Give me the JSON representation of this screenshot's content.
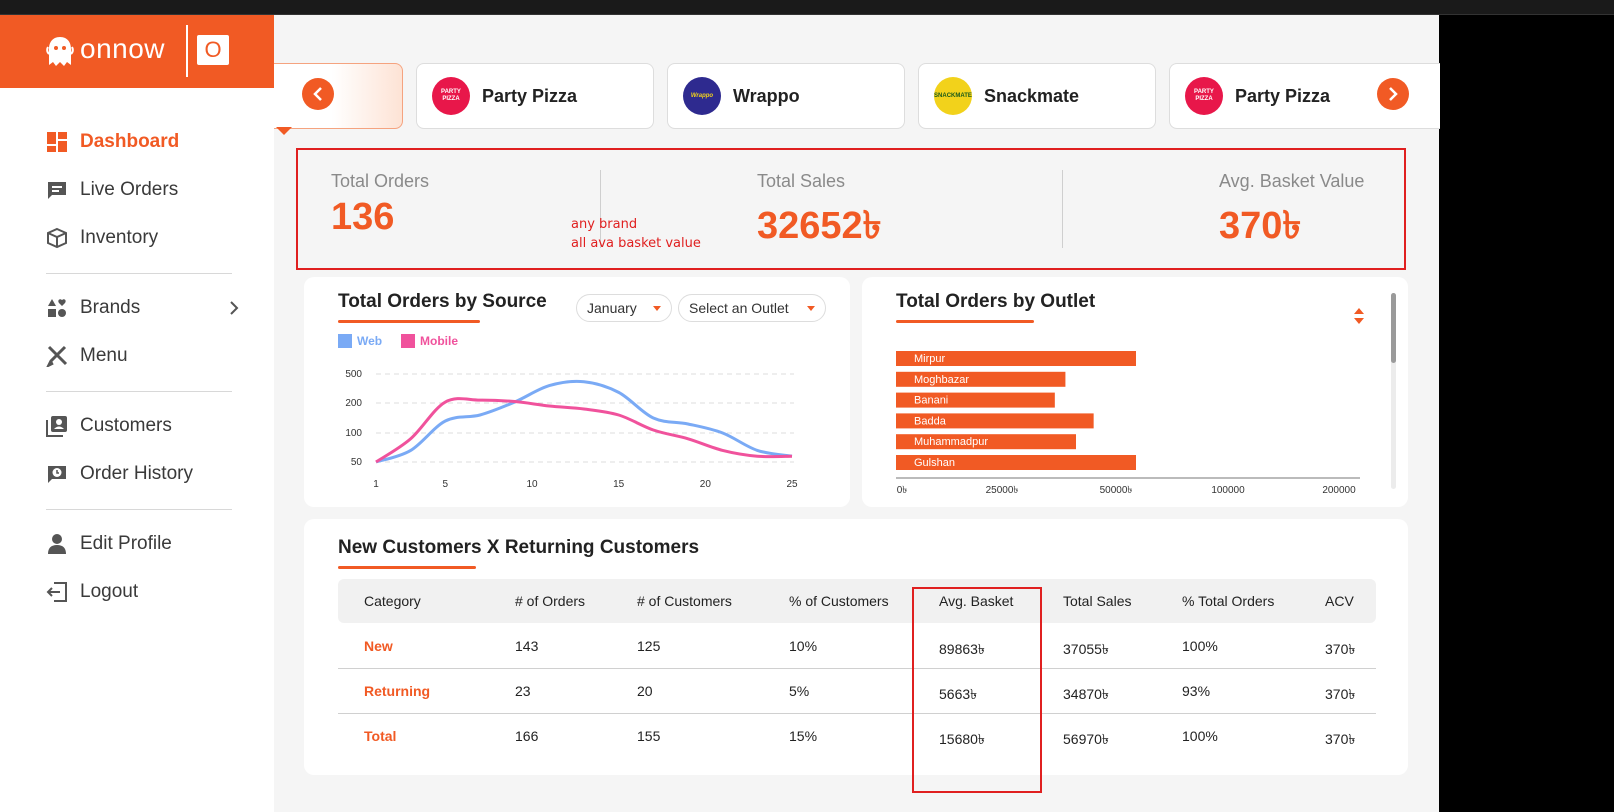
{
  "app": {
    "logo_text": "onnow",
    "logo_badge": "O"
  },
  "colors": {
    "accent": "#f15a24",
    "annotation": "#e02020",
    "web": "#7aaaf5",
    "mobile": "#f0529c"
  },
  "sidebar": {
    "items": [
      {
        "label": "Dashboard",
        "icon": "dashboard-icon",
        "active": true
      },
      {
        "label": "Live Orders",
        "icon": "live-orders-icon"
      },
      {
        "label": "Inventory",
        "icon": "box-icon"
      },
      {
        "label": "Brands",
        "icon": "brands-icon"
      },
      {
        "label": "Menu",
        "icon": "utensils-icon"
      },
      {
        "label": "Customers",
        "icon": "customers-icon"
      },
      {
        "label": "Order History",
        "icon": "order-history-icon"
      },
      {
        "label": "Edit Profile",
        "icon": "user-icon"
      },
      {
        "label": "Logout",
        "icon": "logout-icon"
      }
    ]
  },
  "brands": [
    {
      "name": "Party Pizza",
      "logo": "PARTY PIZZA",
      "color": "#e8174a"
    },
    {
      "name": "Wrappo",
      "logo": "Wrappo",
      "color": "#2e2a8f"
    },
    {
      "name": "Snackmate",
      "logo": "SNACKMATE",
      "color": "#f2d21b"
    },
    {
      "name": "Party Pizza",
      "logo": "PARTY PIZZA",
      "color": "#e8174a"
    }
  ],
  "stats": {
    "total_orders": {
      "label": "Total Orders",
      "value": "136"
    },
    "total_sales": {
      "label": "Total Sales",
      "value": "32652৳"
    },
    "avg_basket": {
      "label": "Avg. Basket Value",
      "value": "370৳"
    },
    "note_line1": "any brand",
    "note_line2": "all ava basket value"
  },
  "orders_by_source": {
    "title": "Total Orders by Source",
    "month_select": "January",
    "outlet_select": "Select an Outlet"
  },
  "orders_by_outlet": {
    "title": "Total Orders by Outlet"
  },
  "chart_data": [
    {
      "type": "line",
      "title": "Total Orders by Source",
      "x": [
        1,
        3,
        5,
        7,
        9,
        11,
        13,
        15,
        17,
        19,
        21,
        23,
        25
      ],
      "xticks": [
        "1",
        "5",
        "10",
        "15",
        "20",
        "25"
      ],
      "yticks": [
        "50",
        "100",
        "200",
        "500"
      ],
      "series": [
        {
          "name": "Web",
          "values": [
            50,
            70,
            140,
            160,
            210,
            380,
            420,
            310,
            150,
            130,
            100,
            70,
            60
          ]
        },
        {
          "name": "Mobile",
          "values": [
            50,
            90,
            210,
            230,
            215,
            190,
            180,
            160,
            110,
            90,
            70,
            60,
            60
          ]
        }
      ],
      "grid": true,
      "legend": "top-left"
    },
    {
      "type": "bar",
      "orientation": "horizontal",
      "title": "Total Orders by Outlet",
      "categories": [
        "Mirpur",
        "Moghbazar",
        "Banani",
        "Badda",
        "Muhammadpur",
        "Gulshan"
      ],
      "values": [
        68000,
        48000,
        45000,
        56000,
        51000,
        68000
      ],
      "xticks": [
        "0৳",
        "25000৳",
        "50000৳",
        "100000",
        "200000"
      ]
    }
  ],
  "customers_table": {
    "title": "New Customers X Returning Customers",
    "columns": [
      "Category",
      "# of Orders",
      "# of Customers",
      "% of Customers",
      "Avg. Basket",
      "Total Sales",
      "% Total Orders",
      "ACV"
    ],
    "rows": [
      [
        "New",
        "143",
        "125",
        "10%",
        "89863৳",
        "37055৳",
        "100%",
        "370৳"
      ],
      [
        "Returning",
        "23",
        "20",
        "5%",
        "5663৳",
        "34870৳",
        "93%",
        "370৳"
      ],
      [
        "Total",
        "166",
        "155",
        "15%",
        "15680৳",
        "56970৳",
        "100%",
        "370৳"
      ]
    ]
  }
}
